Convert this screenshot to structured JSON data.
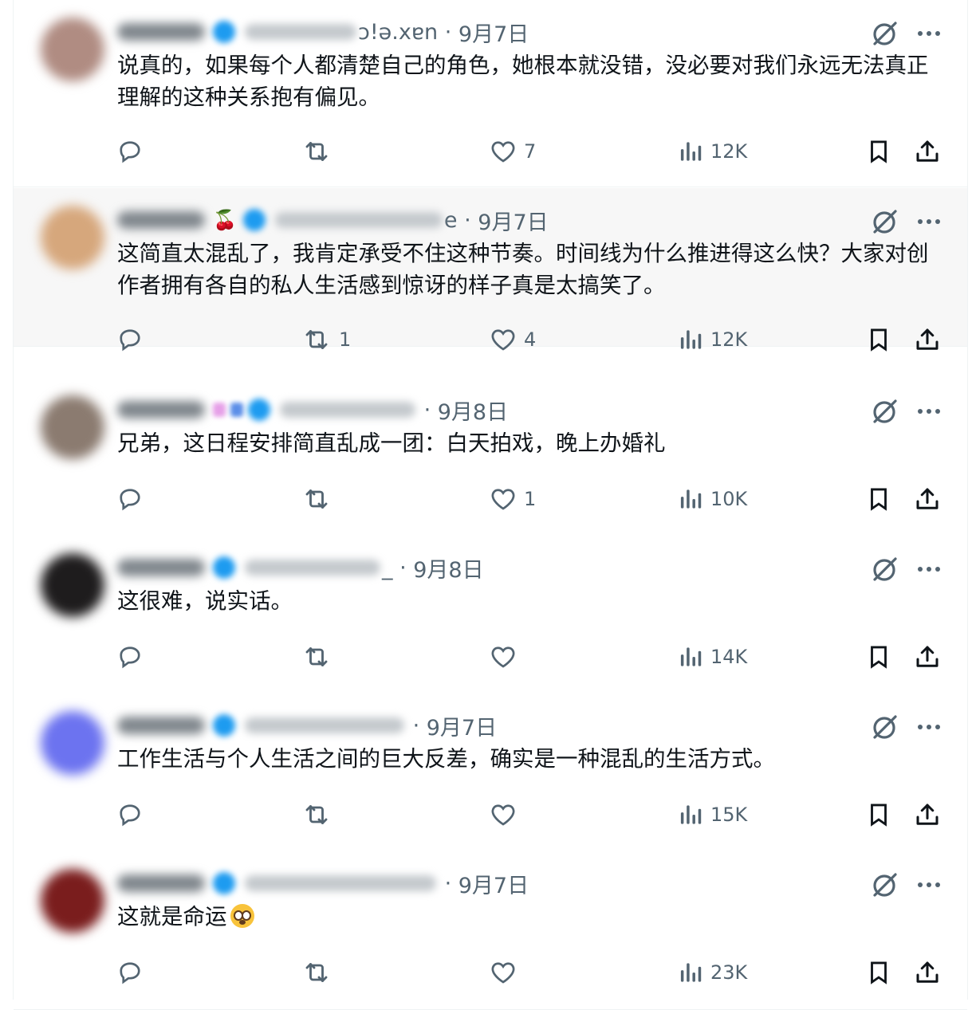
{
  "tweets": [
    {
      "date": "9月7日",
      "handle_tail": "ɔ!ə.xɐn",
      "text": "说真的，如果每个人都清楚自己的角色，她根本就没错，没必要对我们永远无法真正理解的这种关系抱有偏见。",
      "reply_count": "",
      "retweet_count": "",
      "like_count": "7",
      "view_count": "12K",
      "avatar_color": "#b08c82",
      "has_cherry": false
    },
    {
      "date": "9月7日",
      "handle_tail": "e",
      "text": "这简直太混乱了，我肯定承受不住这种节奏。时间线为什么推进得这么快？大家对创作者拥有各自的私人生活感到惊讶的样子真是太搞笑了。",
      "reply_count": "",
      "retweet_count": "1",
      "like_count": "4",
      "view_count": "12K",
      "avatar_color": "#d6a77c",
      "has_cherry": true,
      "cherry": "🍒"
    },
    {
      "date": "9月8日",
      "handle_tail": "",
      "text": "兄弟，这日程安排简直乱成一团：白天拍戏，晚上办婚礼",
      "reply_count": "",
      "retweet_count": "",
      "like_count": "1",
      "view_count": "10K",
      "avatar_color": "#8b7b70",
      "has_cherry": false
    },
    {
      "date": "9月8日",
      "handle_tail": "_",
      "text": "这很难，说实话。",
      "reply_count": "",
      "retweet_count": "",
      "like_count": "",
      "view_count": "14K",
      "avatar_color": "#1e1c1d",
      "has_cherry": false
    },
    {
      "date": "9月7日",
      "handle_tail": "",
      "text": "工作生活与个人生活之间的巨大反差，确实是一种混乱的生活方式。",
      "reply_count": "",
      "retweet_count": "",
      "like_count": "",
      "view_count": "15K",
      "avatar_color": "#6c73f0",
      "has_cherry": false
    },
    {
      "date": "9月7日",
      "handle_tail": "",
      "text": "这就是命运",
      "reply_count": "",
      "retweet_count": "",
      "like_count": "",
      "view_count": "23K",
      "avatar_color": "#7a1d1d",
      "has_cherry": false,
      "emoji": "😳"
    }
  ],
  "colors": {
    "icon_gray": "#536471",
    "text": "#0f1419",
    "divider": "#eff3f4",
    "verified": "#1d9bf0",
    "hover_bg": "#f7f7f7"
  },
  "icons": [
    "reply-icon",
    "retweet-icon",
    "like-icon",
    "views-icon",
    "bookmark-icon",
    "share-icon",
    "grok-icon",
    "more-icon"
  ]
}
